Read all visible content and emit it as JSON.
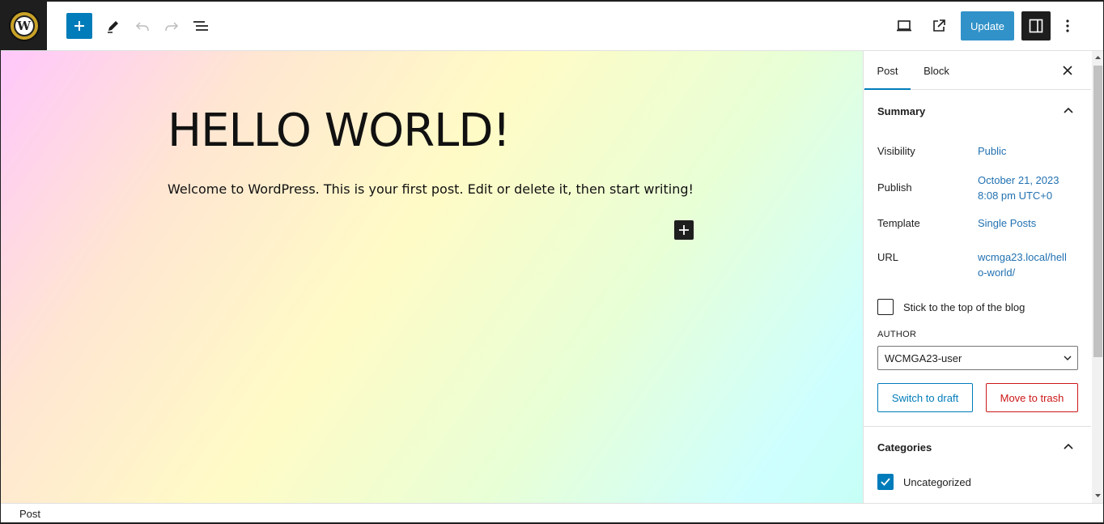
{
  "toolbar": {
    "update_label": "Update",
    "logo_letter": "W"
  },
  "post": {
    "title": "HELLO WORLD!",
    "content": "Welcome to WordPress. This is your first post. Edit or delete it, then start writing!"
  },
  "sidebar": {
    "tabs": [
      {
        "label": "Post",
        "active": true
      },
      {
        "label": "Block",
        "active": false
      }
    ],
    "summary": {
      "heading": "Summary",
      "visibility_label": "Visibility",
      "visibility_value": "Public",
      "publish_label": "Publish",
      "publish_date": "October 21, 2023",
      "publish_time": "8:08 pm UTC+0",
      "template_label": "Template",
      "template_value": "Single Posts",
      "url_label": "URL",
      "url_line1": "wcmga23.local/hell",
      "url_line2": "o-world/",
      "sticky_label": "Stick to the top of the blog",
      "sticky_checked": false,
      "author_heading": "AUTHOR",
      "author_value": "WCMGA23-user",
      "switch_draft_label": "Switch to draft",
      "move_trash_label": "Move to trash"
    },
    "categories": {
      "heading": "Categories",
      "items": [
        {
          "label": "Uncategorized",
          "checked": true
        }
      ]
    }
  },
  "footer": {
    "breadcrumb": "Post"
  },
  "colors": {
    "accent": "#007cba",
    "update_button": "#3192c9",
    "danger": "#cc1818",
    "link": "#2271b1"
  }
}
